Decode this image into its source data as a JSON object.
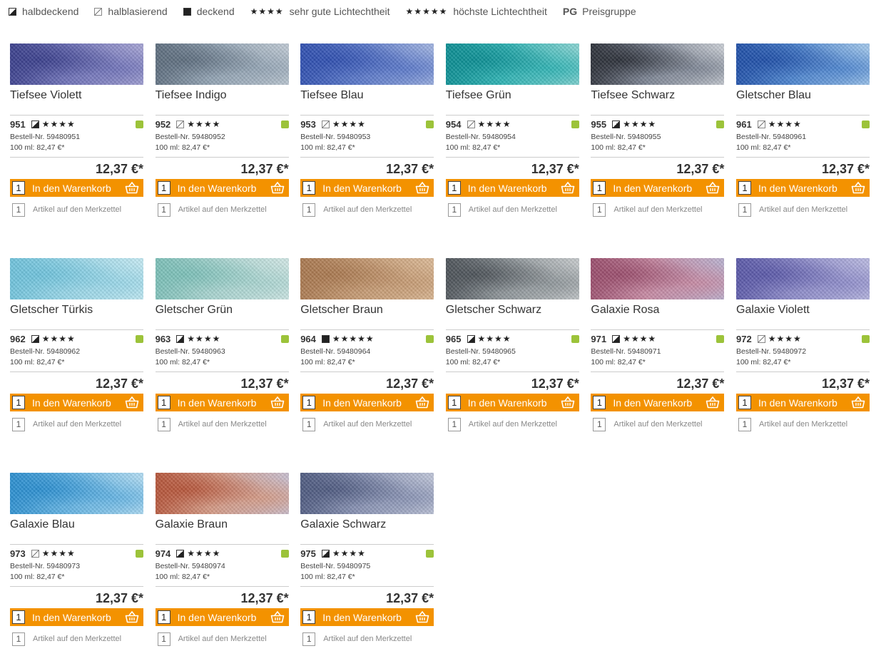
{
  "legend": {
    "halbdeckend": "halbdeckend",
    "halblasierend": "halblasierend",
    "deckend": "deckend",
    "stars4": "★★★★",
    "stars4_label": "sehr gute Lichtechtheit",
    "stars5": "★★★★★",
    "stars5_label": "höchste Lichtechtheit",
    "pg": "PG",
    "pg_label": "Preisgruppe"
  },
  "common": {
    "price": "12,37 €*",
    "unit_price": "100 ml: 82,47 €*",
    "cart_qty": "1",
    "cart_label": "In den Warenkorb",
    "memo_qty": "1",
    "memo_label": "Artikel auf den Merkzettel",
    "pg_color": "#9cc33a",
    "accent": "#f39200"
  },
  "products": [
    {
      "name": "Tiefsee Violett",
      "number": "951",
      "opacity": "halbdeckend",
      "stars": "★★★★",
      "order": "Bestell-Nr. 59480951",
      "colors": [
        "#3a3f8c",
        "#6f72b8",
        "#a9a7d6"
      ]
    },
    {
      "name": "Tiefsee Indigo",
      "number": "952",
      "opacity": "halblasierend",
      "stars": "★★★★",
      "order": "Bestell-Nr. 59480952",
      "colors": [
        "#5d6d7e",
        "#93a4b4",
        "#c2ccd6"
      ]
    },
    {
      "name": "Tiefsee Blau",
      "number": "953",
      "opacity": "halblasierend",
      "stars": "★★★★",
      "order": "Bestell-Nr. 59480953",
      "colors": [
        "#2f4fb0",
        "#5a78c9",
        "#a6b8e3"
      ]
    },
    {
      "name": "Tiefsee Grün",
      "number": "954",
      "opacity": "halblasierend",
      "stars": "★★★★",
      "order": "Bestell-Nr. 59480954",
      "colors": [
        "#0b8e93",
        "#2fb3b4",
        "#8fd6d4"
      ]
    },
    {
      "name": "Tiefsee Schwarz",
      "number": "955",
      "opacity": "halbdeckend",
      "stars": "★★★★",
      "order": "Bestell-Nr. 59480955",
      "colors": [
        "#2b2f38",
        "#7d8594",
        "#d0d4da"
      ]
    },
    {
      "name": "Gletscher Blau",
      "number": "961",
      "opacity": "halblasierend",
      "stars": "★★★★",
      "order": "Bestell-Nr. 59480961",
      "colors": [
        "#1f4fa8",
        "#4d85cf",
        "#a9cdee"
      ]
    },
    {
      "name": "Gletscher Türkis",
      "number": "962",
      "opacity": "halbdeckend",
      "stars": "★★★★",
      "order": "Bestell-Nr. 59480962",
      "colors": [
        "#6fc3dc",
        "#98d6e8",
        "#c7ebf3"
      ]
    },
    {
      "name": "Gletscher Grün",
      "number": "963",
      "opacity": "halbdeckend",
      "stars": "★★★★",
      "order": "Bestell-Nr. 59480963",
      "colors": [
        "#7cc0b8",
        "#a9d4d0",
        "#d3e8e6"
      ]
    },
    {
      "name": "Gletscher Braun",
      "number": "964",
      "opacity": "deckend",
      "stars": "★★★★★",
      "order": "Bestell-Nr. 59480964",
      "colors": [
        "#a9784f",
        "#c59a73",
        "#dcbb98"
      ]
    },
    {
      "name": "Gletscher Schwarz",
      "number": "965",
      "opacity": "halbdeckend",
      "stars": "★★★★",
      "order": "Bestell-Nr. 59480965",
      "colors": [
        "#4c5258",
        "#8e9599",
        "#c9cdcf"
      ]
    },
    {
      "name": "Galaxie Rosa",
      "number": "971",
      "opacity": "halbdeckend",
      "stars": "★★★★",
      "order": "Bestell-Nr. 59480971",
      "colors": [
        "#9a4d6c",
        "#c78aa3",
        "#b8b4d2"
      ]
    },
    {
      "name": "Galaxie Violett",
      "number": "972",
      "opacity": "halblasierend",
      "stars": "★★★★",
      "order": "Bestell-Nr. 59480972",
      "colors": [
        "#5a58a8",
        "#8d8bc9",
        "#bcbce2"
      ]
    },
    {
      "name": "Galaxie Blau",
      "number": "973",
      "opacity": "halblasierend",
      "stars": "★★★★",
      "order": "Bestell-Nr. 59480973",
      "colors": [
        "#2b8fd0",
        "#63b3e3",
        "#b9e0f4"
      ]
    },
    {
      "name": "Galaxie Braun",
      "number": "974",
      "opacity": "halbdeckend",
      "stars": "★★★★",
      "order": "Bestell-Nr. 59480974",
      "colors": [
        "#b6553a",
        "#d49a85",
        "#c7c2d6"
      ]
    },
    {
      "name": "Galaxie Schwarz",
      "number": "975",
      "opacity": "halbdeckend",
      "stars": "★★★★",
      "order": "Bestell-Nr. 59480975",
      "colors": [
        "#4e5a80",
        "#8892b3",
        "#c3c9db"
      ]
    }
  ]
}
